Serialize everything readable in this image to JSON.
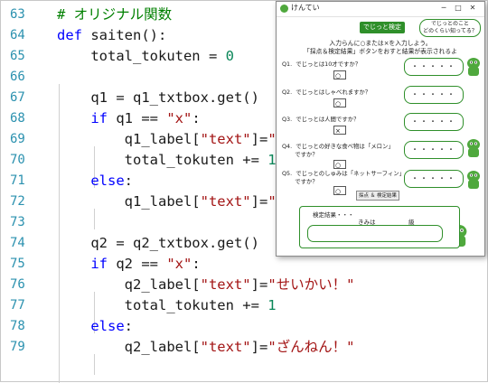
{
  "editor": {
    "lines": [
      {
        "num": "63",
        "code": "# オリジナル関数"
      },
      {
        "num": "64",
        "code": "def saiten():"
      },
      {
        "num": "65",
        "code": "    total_tokuten = 0"
      },
      {
        "num": "66",
        "code": ""
      },
      {
        "num": "67",
        "code": "    q1 = q1_txtbox.get()"
      },
      {
        "num": "68",
        "code": "    if q1 == \"x\":"
      },
      {
        "num": "69",
        "code": "        q1_label[\"text\"]=\""
      },
      {
        "num": "70",
        "code": "        total_tokuten += 1"
      },
      {
        "num": "71",
        "code": "    else:"
      },
      {
        "num": "72",
        "code": "        q1_label[\"text\"]=\""
      },
      {
        "num": "73",
        "code": ""
      },
      {
        "num": "74",
        "code": "    q2 = q2_txtbox.get()"
      },
      {
        "num": "75",
        "code": "    if q2 == \"x\":"
      },
      {
        "num": "76",
        "code": "        q2_label[\"text\"]=\"せいかい！\""
      },
      {
        "num": "77",
        "code": "        total_tokuten += 1"
      },
      {
        "num": "78",
        "code": "    else:"
      },
      {
        "num": "79",
        "code": "        q2_label[\"text\"]=\"ざんねん！\""
      }
    ]
  },
  "app": {
    "window_title": "けんてい",
    "title_badge": "でじっと検定",
    "bubble_text_1": "でじっとのこと",
    "bubble_text_2": "どのくらい知ってる？",
    "instruction_1": "入力らんに○または×を入力しよう。",
    "instruction_2": "「採点＆検定結果」ボタンをおすと結果が表示されるよ",
    "questions": [
      {
        "label": "Q1.  でじっとは10才ですか？",
        "value": "○",
        "answer": "・・・・・"
      },
      {
        "label": "Q2.  でじっとはしゃべれますか？",
        "value": "○",
        "answer": "・・・・・"
      },
      {
        "label": "Q3.  でじっとは人間ですか？",
        "value": "×",
        "answer": "・・・・・"
      },
      {
        "label": "Q4.  でじっとの好きな食べ物は「メロン」\n       ですか？",
        "value": "○",
        "answer": "・・・・・"
      },
      {
        "label": "Q5.  でじっとのしゅみは「ネットサーフィン」\n       ですか？",
        "value": "○",
        "answer": "・・・・・"
      }
    ],
    "score_button": "採点 ＆ 検定結果",
    "result_title": "検定結果・・・",
    "result_name_label": "きみは",
    "result_grade_label": "級"
  },
  "colors": {
    "accent": "#2f8f2a",
    "line_number": "#2b91af",
    "keyword": "#0000ff",
    "string": "#a31515",
    "number": "#098658",
    "comment": "#008000"
  }
}
